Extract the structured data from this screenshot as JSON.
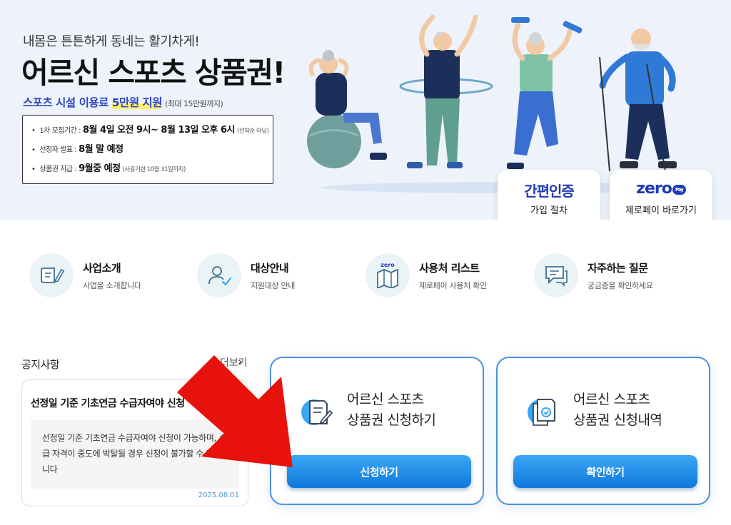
{
  "hero": {
    "subtitle": "내몸은 튼튼하게 동네는 활기차게!",
    "title": "어르신 스포츠 상품권!",
    "support_prefix": "스포츠 시설 이용료 ",
    "support_highlight": "5만원 지원",
    "support_note": "(최대 15만원까지)",
    "info": [
      {
        "label": "1차 모집기간 :",
        "value": "8월 4일 오전 9시~ 8월 13일 오후 6시",
        "note": "(선착순 아님)"
      },
      {
        "label": "선정자 발표 :",
        "value": "8월 말 예정",
        "note": ""
      },
      {
        "label": "상품권 지급 :",
        "value": "9월중 예정",
        "note": "(사용기한 10월 31일까지)"
      }
    ],
    "shortcuts": [
      {
        "big": "간편인증",
        "small": "가입 절차"
      },
      {
        "big": "zero",
        "badge": "Pay",
        "small": "제로페이 바로가기"
      }
    ]
  },
  "menu": [
    {
      "title": "사업소개",
      "desc": "사업을 소개합니다",
      "icon": "book-edit-icon"
    },
    {
      "title": "대상안내",
      "desc": "지원대상 안내",
      "icon": "user-check-icon"
    },
    {
      "title": "사용처 리스트",
      "desc": "제로페이 사용처 확인",
      "icon": "map-icon",
      "icon_text": "zero"
    },
    {
      "title": "자주하는 질문",
      "desc": "궁금증을 확인하세요",
      "icon": "chat-bubble-icon"
    }
  ],
  "notice": {
    "heading": "공지사항",
    "more": "더보기",
    "title": "선정일 기준 기초연금 수급자여야 신청",
    "body": "선정일 기준 기초연금 수급자여야 신청이 가능하며, 수급 자격이 중도에 박탈될 경우 신청이 불가할 수 있습니다",
    "date": "2025.08.01"
  },
  "apply": [
    {
      "line1": "어르신 스포츠",
      "line2": "상품권 신청하기",
      "button": "신청하기",
      "icon": "apply-document-icon"
    },
    {
      "line1": "어르신 스포츠",
      "line2": "상품권 신청내역",
      "button": "확인하기",
      "icon": "history-document-icon"
    }
  ],
  "colors": {
    "brand_blue": "#1e3bb5",
    "button_blue": "#1178dc",
    "arrow_red": "#e8120c",
    "hero_bg": "#eef3fb"
  }
}
